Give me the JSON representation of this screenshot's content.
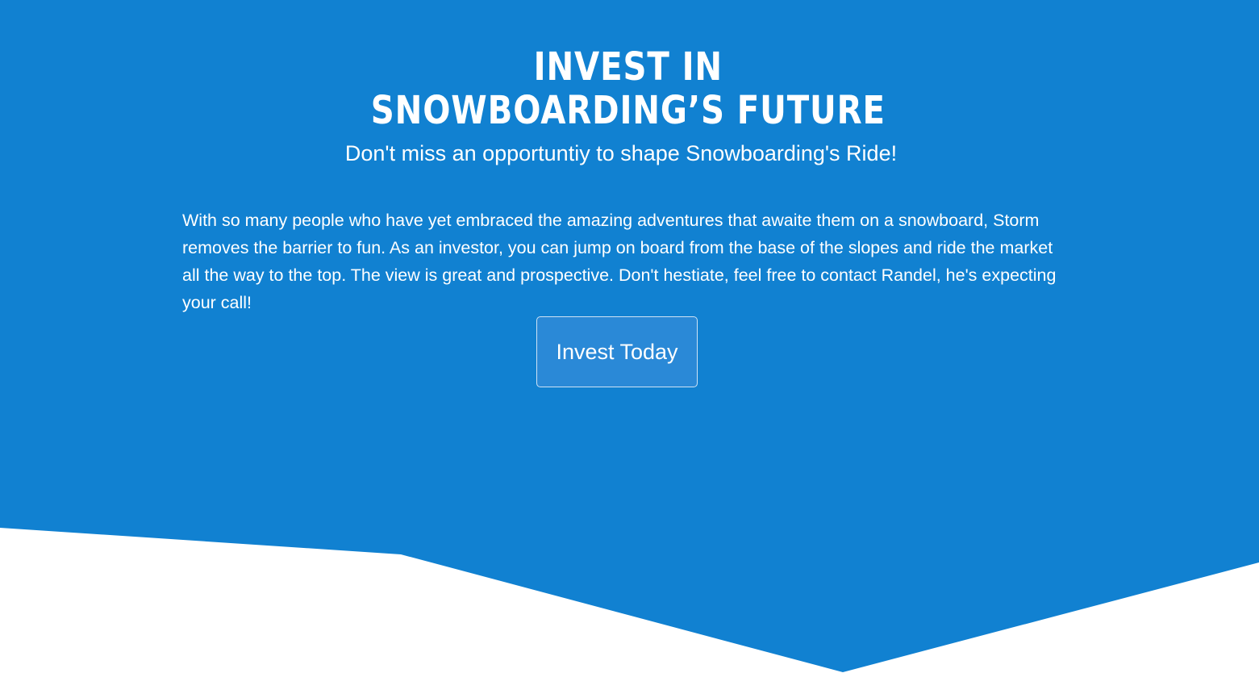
{
  "hero": {
    "title_line1": "Invest in",
    "title_line2": "Snowboarding’s Future",
    "subtitle": "Don't miss an opportuntiy to shape Snowboarding's Ride!",
    "body": "With so many people who have yet embraced the amazing adventures that awaite them on a snowboard, Storm removes the barrier to fun. As an investor, you can jump on board from the base of the slopes and ride the market all the way to the top. The view is great and prospective. Don't hestiate, feel free to contact Randel, he's expecting your call!",
    "cta_label": "Invest Today"
  },
  "colors": {
    "hero_background": "#1181d1",
    "page_background": "#ffffff",
    "text": "#ffffff"
  }
}
